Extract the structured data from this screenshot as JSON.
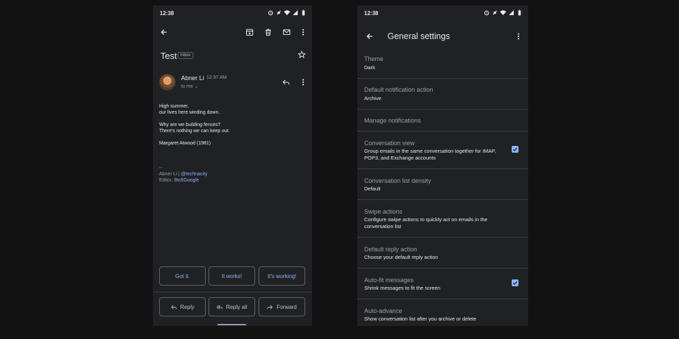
{
  "left_screen": {
    "status": {
      "time": "12:38"
    },
    "subject": "Test",
    "label_chip": "Inbox",
    "sender": {
      "name": "Abner Li",
      "time": "12:37 AM",
      "to": "to me"
    },
    "body": {
      "line1": "High summer,",
      "line2": "our lives here winding down.",
      "line3": "Why are we building fences?",
      "line4": "There's nothing we can keep out.",
      "line5": "Margaret Atwood (1981)",
      "sig_dash": "--",
      "sig_name": "Abner Li | ",
      "sig_handle": "@technacity",
      "sig_role": "Editor, ",
      "sig_site": "9to5Google"
    },
    "smart_replies": [
      "Got it.",
      "It works!",
      "It's working!"
    ],
    "actions": {
      "reply": "Reply",
      "reply_all": "Reply all",
      "forward": "Forward"
    },
    "icons": [
      "back-arrow-icon",
      "archive-icon",
      "delete-icon",
      "mail-icon",
      "more-vert-icon",
      "star-icon",
      "reply-icon"
    ]
  },
  "right_screen": {
    "status": {
      "time": "12:38"
    },
    "title": "General settings",
    "settings": [
      {
        "label": "Theme",
        "value": "Dark"
      },
      {
        "label": "Default notification action",
        "value": "Archive"
      },
      {
        "label": "Manage notifications",
        "value": ""
      },
      {
        "label": "Conversation view",
        "value": "Group emails in the same conversation together for IMAP, POP3, and Exchange accounts",
        "checked": true
      },
      {
        "label": "Conversation list density",
        "value": "Default"
      },
      {
        "label": "Swipe actions",
        "value": "Configure swipe actions to quickly act on emails in the conversation list"
      },
      {
        "label": "Default reply action",
        "value": "Choose your default reply action"
      },
      {
        "label": "Auto-fit messages",
        "value": "Shrink messages to fit the screen",
        "checked": true
      },
      {
        "label": "Auto-advance",
        "value": "Show conversation list after you archive or delete"
      }
    ]
  },
  "colors": {
    "background": "#121212",
    "surface": "#202124",
    "accent": "#8ab4f8",
    "divider": "#3c4043"
  }
}
